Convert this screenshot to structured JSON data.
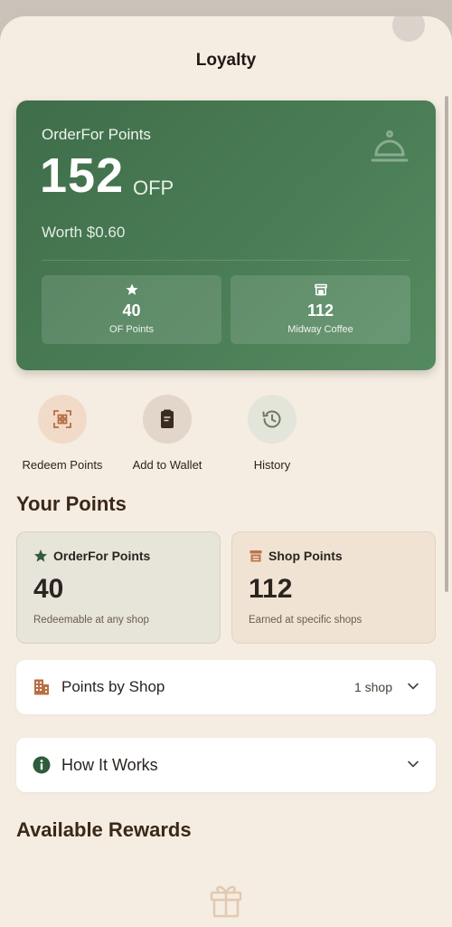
{
  "header": {
    "title": "Loyalty"
  },
  "hero": {
    "label": "OrderFor Points",
    "value": "152",
    "unit": "OFP",
    "worth": "Worth $0.60",
    "stats": [
      {
        "value": "40",
        "label": "OF Points",
        "icon": "star-icon"
      },
      {
        "value": "112",
        "label": "Midway Coffee",
        "icon": "store-icon"
      }
    ]
  },
  "actions": [
    {
      "label": "Redeem Points",
      "icon": "qr-scan-icon"
    },
    {
      "label": "Add to Wallet",
      "icon": "wallet-icon"
    },
    {
      "label": "History",
      "icon": "history-icon"
    }
  ],
  "your_points": {
    "title": "Your Points",
    "cards": [
      {
        "title": "OrderFor Points",
        "value": "40",
        "subtitle": "Redeemable at any shop",
        "icon": "star-icon"
      },
      {
        "title": "Shop Points",
        "value": "112",
        "subtitle": "Earned at specific shops",
        "icon": "store-icon"
      }
    ]
  },
  "points_by_shop": {
    "label": "Points by Shop",
    "meta": "1 shop"
  },
  "how_it_works": {
    "label": "How It Works"
  },
  "available_rewards": {
    "title": "Available Rewards"
  },
  "colors": {
    "brand_green": "#3f6e4a",
    "background": "#f5ede2",
    "accent_orange": "#c0734a"
  }
}
